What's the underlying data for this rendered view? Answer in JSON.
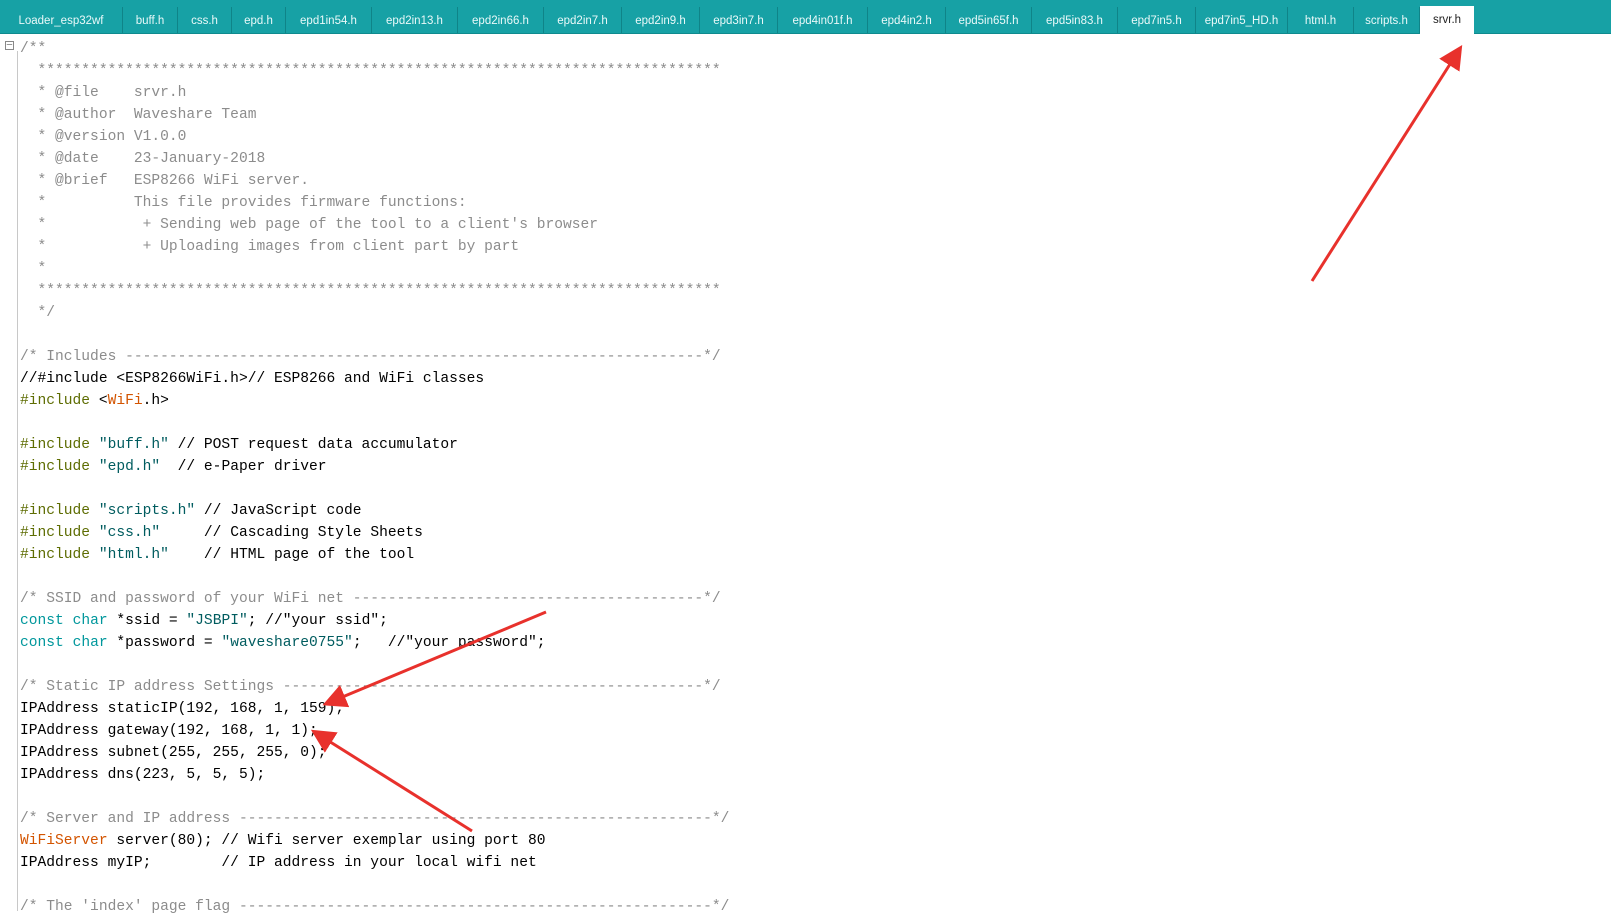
{
  "tabs": [
    {
      "label": "Loader_esp32wf"
    },
    {
      "label": "buff.h"
    },
    {
      "label": "css.h"
    },
    {
      "label": "epd.h"
    },
    {
      "label": "epd1in54.h"
    },
    {
      "label": "epd2in13.h"
    },
    {
      "label": "epd2in66.h"
    },
    {
      "label": "epd2in7.h"
    },
    {
      "label": "epd2in9.h"
    },
    {
      "label": "epd3in7.h"
    },
    {
      "label": "epd4in01f.h"
    },
    {
      "label": "epd4in2.h"
    },
    {
      "label": "epd5in65f.h"
    },
    {
      "label": "epd5in83.h"
    },
    {
      "label": "epd7in5.h"
    },
    {
      "label": "epd7in5_HD.h"
    },
    {
      "label": "html.h"
    },
    {
      "label": "scripts.h"
    },
    {
      "label": "srvr.h"
    }
  ],
  "active_tab": "srvr.h",
  "fold_icon": "minus-box",
  "colors": {
    "tabbar": "#17a1a5",
    "comment": "#8c8c8c",
    "preprocessor": "#5e6d03",
    "string": "#005c5f",
    "keyword": "#00979c",
    "class": "#d35400",
    "arrow": "#e8312c"
  },
  "code_lines": [
    [
      {
        "t": "/**",
        "c": "com"
      }
    ],
    [
      {
        "t": "  ******************************************************************************",
        "c": "com"
      }
    ],
    [
      {
        "t": "  * @file    srvr.h",
        "c": "com"
      }
    ],
    [
      {
        "t": "  * @author  Waveshare Team",
        "c": "com"
      }
    ],
    [
      {
        "t": "  * @version V1.0.0",
        "c": "com"
      }
    ],
    [
      {
        "t": "  * @date    23-January-2018",
        "c": "com"
      }
    ],
    [
      {
        "t": "  * @brief   ESP8266 WiFi server.",
        "c": "com"
      }
    ],
    [
      {
        "t": "  *          This file provides firmware functions:",
        "c": "com"
      }
    ],
    [
      {
        "t": "  *           + Sending web page of the tool to a client's browser",
        "c": "com"
      }
    ],
    [
      {
        "t": "  *           + Uploading images from client part by part",
        "c": "com"
      }
    ],
    [
      {
        "t": "  *",
        "c": "com"
      }
    ],
    [
      {
        "t": "  ******************************************************************************",
        "c": "com"
      }
    ],
    [
      {
        "t": "  */",
        "c": "com"
      }
    ],
    [],
    [
      {
        "t": "/* Includes ------------------------------------------------------------------*/",
        "c": "com"
      }
    ],
    [
      {
        "t": "//#include <ESP8266WiFi.h>// ESP8266 and WiFi classes",
        "c": "plain"
      }
    ],
    [
      {
        "t": "#include",
        "c": "pp"
      },
      {
        "t": " <",
        "c": "plain"
      },
      {
        "t": "WiFi",
        "c": "cls"
      },
      {
        "t": ".h>",
        "c": "plain"
      }
    ],
    [],
    [
      {
        "t": "#include",
        "c": "pp"
      },
      {
        "t": " ",
        "c": "plain"
      },
      {
        "t": "\"buff.h\"",
        "c": "str"
      },
      {
        "t": " // POST request data accumulator",
        "c": "plain"
      }
    ],
    [
      {
        "t": "#include",
        "c": "pp"
      },
      {
        "t": " ",
        "c": "plain"
      },
      {
        "t": "\"epd.h\"",
        "c": "str"
      },
      {
        "t": "  // e-Paper driver",
        "c": "plain"
      }
    ],
    [],
    [
      {
        "t": "#include",
        "c": "pp"
      },
      {
        "t": " ",
        "c": "plain"
      },
      {
        "t": "\"scripts.h\"",
        "c": "str"
      },
      {
        "t": " // JavaScript code",
        "c": "plain"
      }
    ],
    [
      {
        "t": "#include",
        "c": "pp"
      },
      {
        "t": " ",
        "c": "plain"
      },
      {
        "t": "\"css.h\"",
        "c": "str"
      },
      {
        "t": "     // Cascading Style Sheets",
        "c": "plain"
      }
    ],
    [
      {
        "t": "#include",
        "c": "pp"
      },
      {
        "t": " ",
        "c": "plain"
      },
      {
        "t": "\"html.h\"",
        "c": "str"
      },
      {
        "t": "    // HTML page of the tool",
        "c": "plain"
      }
    ],
    [],
    [
      {
        "t": "/* SSID and password of your WiFi net ----------------------------------------*/",
        "c": "com"
      }
    ],
    [
      {
        "t": "const",
        "c": "kw"
      },
      {
        "t": " ",
        "c": "plain"
      },
      {
        "t": "char",
        "c": "kw"
      },
      {
        "t": " *ssid = ",
        "c": "plain"
      },
      {
        "t": "\"JSBPI\"",
        "c": "str"
      },
      {
        "t": "; //\"your ssid\";",
        "c": "plain"
      }
    ],
    [
      {
        "t": "const",
        "c": "kw"
      },
      {
        "t": " ",
        "c": "plain"
      },
      {
        "t": "char",
        "c": "kw"
      },
      {
        "t": " *password = ",
        "c": "plain"
      },
      {
        "t": "\"waveshare0755\"",
        "c": "str"
      },
      {
        "t": ";   //\"your password\";",
        "c": "plain"
      }
    ],
    [],
    [
      {
        "t": "/* Static IP address Settings ------------------------------------------------*/",
        "c": "com"
      }
    ],
    [
      {
        "t": "IPAddress staticIP(192, 168, 1, 159);",
        "c": "plain"
      }
    ],
    [
      {
        "t": "IPAddress gateway(192, 168, 1, 1);",
        "c": "plain"
      }
    ],
    [
      {
        "t": "IPAddress subnet(255, 255, 255, 0);",
        "c": "plain"
      }
    ],
    [
      {
        "t": "IPAddress dns(223, 5, 5, 5);",
        "c": "plain"
      }
    ],
    [],
    [
      {
        "t": "/* Server and IP address ------------------------------------------------------*/",
        "c": "com"
      }
    ],
    [
      {
        "t": "WiFiServer",
        "c": "cls"
      },
      {
        "t": " server(80); // Wifi server exemplar using port 80",
        "c": "plain"
      }
    ],
    [
      {
        "t": "IPAddress myIP;        // IP address in your local wifi net",
        "c": "plain"
      }
    ],
    [],
    [
      {
        "t": "/* The 'index' page flag ------------------------------------------------------*/",
        "c": "com"
      }
    ]
  ]
}
